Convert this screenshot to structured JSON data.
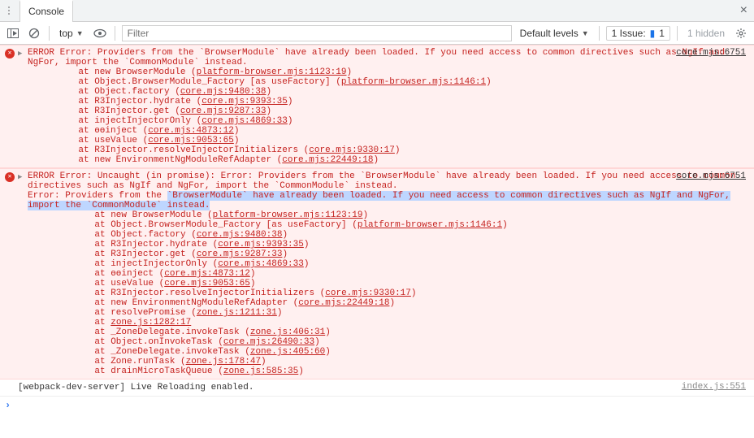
{
  "tabs": {
    "console": "Console"
  },
  "toolbar": {
    "context": "top",
    "filter_placeholder": "Filter",
    "levels": "Default levels",
    "issues_label": "1 Issue:",
    "issues_count": "1",
    "hidden": "1 hidden"
  },
  "errors": [
    {
      "source": "core.mjs:6751",
      "head": "ERROR Error: Providers from the `BrowserModule` have already been loaded. If you need access to common directives such as NgIf and NgFor, import the `CommonModule` instead.",
      "stack": [
        {
          "prefix": "at new BrowserModule (",
          "link": "platform-browser.mjs:1123:19",
          "suffix": ")"
        },
        {
          "prefix": "at Object.BrowserModule_Factory [as useFactory] (",
          "link": "platform-browser.mjs:1146:1",
          "suffix": ")"
        },
        {
          "prefix": "at Object.factory (",
          "link": "core.mjs:9480:38",
          "suffix": ")"
        },
        {
          "prefix": "at R3Injector.hydrate (",
          "link": "core.mjs:9393:35",
          "suffix": ")"
        },
        {
          "prefix": "at R3Injector.get (",
          "link": "core.mjs:9287:33",
          "suffix": ")"
        },
        {
          "prefix": "at injectInjectorOnly (",
          "link": "core.mjs:4869:33",
          "suffix": ")"
        },
        {
          "prefix": "at ɵɵinject (",
          "link": "core.mjs:4873:12",
          "suffix": ")"
        },
        {
          "prefix": "at useValue (",
          "link": "core.mjs:9053:65",
          "suffix": ")"
        },
        {
          "prefix": "at R3Injector.resolveInjectorInitializers (",
          "link": "core.mjs:9330:17",
          "suffix": ")"
        },
        {
          "prefix": "at new EnvironmentNgModuleRefAdapter (",
          "link": "core.mjs:22449:18",
          "suffix": ")"
        }
      ]
    },
    {
      "source": "core.mjs:6751",
      "head": "ERROR Error: Uncaught (in promise): Error: Providers from the `BrowserModule` have already been loaded. If you need access to common directives such as NgIf and NgFor, import the `CommonModule` instead.",
      "highlight_pre": "Error: Providers from the ",
      "highlight": "`BrowserModule` have already been loaded. If you need access to common directives such as NgIf and NgFor, import the `CommonModule` instead.",
      "stack": [
        {
          "prefix": "at new BrowserModule (",
          "link": "platform-browser.mjs:1123:19",
          "suffix": ")"
        },
        {
          "prefix": "at Object.BrowserModule_Factory [as useFactory] (",
          "link": "platform-browser.mjs:1146:1",
          "suffix": ")"
        },
        {
          "prefix": "at Object.factory (",
          "link": "core.mjs:9480:38",
          "suffix": ")"
        },
        {
          "prefix": "at R3Injector.hydrate (",
          "link": "core.mjs:9393:35",
          "suffix": ")"
        },
        {
          "prefix": "at R3Injector.get (",
          "link": "core.mjs:9287:33",
          "suffix": ")"
        },
        {
          "prefix": "at injectInjectorOnly (",
          "link": "core.mjs:4869:33",
          "suffix": ")"
        },
        {
          "prefix": "at ɵɵinject (",
          "link": "core.mjs:4873:12",
          "suffix": ")"
        },
        {
          "prefix": "at useValue (",
          "link": "core.mjs:9053:65",
          "suffix": ")"
        },
        {
          "prefix": "at R3Injector.resolveInjectorInitializers (",
          "link": "core.mjs:9330:17",
          "suffix": ")"
        },
        {
          "prefix": "at new EnvironmentNgModuleRefAdapter (",
          "link": "core.mjs:22449:18",
          "suffix": ")"
        },
        {
          "prefix": "at resolvePromise (",
          "link": "zone.js:1211:31",
          "suffix": ")"
        },
        {
          "prefix": "at ",
          "link": "zone.js:1282:17",
          "suffix": ""
        },
        {
          "prefix": "at _ZoneDelegate.invokeTask (",
          "link": "zone.js:406:31",
          "suffix": ")"
        },
        {
          "prefix": "at Object.onInvokeTask (",
          "link": "core.mjs:26490:33",
          "suffix": ")"
        },
        {
          "prefix": "at _ZoneDelegate.invokeTask (",
          "link": "zone.js:405:60",
          "suffix": ")"
        },
        {
          "prefix": "at Zone.runTask (",
          "link": "zone.js:178:47",
          "suffix": ")"
        },
        {
          "prefix": "at drainMicroTaskQueue (",
          "link": "zone.js:585:35",
          "suffix": ")"
        }
      ]
    }
  ],
  "log_entry": {
    "text": "[webpack-dev-server] Live Reloading enabled.",
    "source": "index.js:551"
  }
}
